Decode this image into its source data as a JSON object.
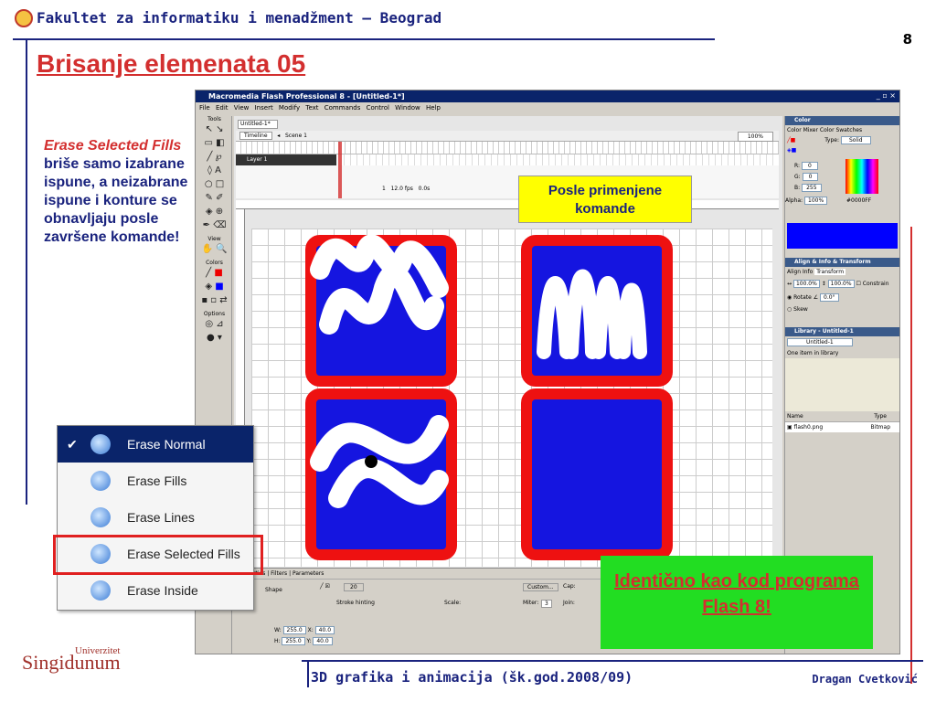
{
  "header": {
    "institution": "Fakultet za informatiku i menadžment – Beograd",
    "page_number": "8"
  },
  "title": "Brisanje elemenata 05",
  "description": {
    "highlight": "Erase Selected Fills",
    "rest": "briše samo izabrane ispune, a neizabrane ispune i konture se obnavljaju posle završene komande!"
  },
  "flash": {
    "window_title": "Macromedia Flash Professional 8 - [Untitled-1*]",
    "menu": [
      "File",
      "Edit",
      "View",
      "Insert",
      "Modify",
      "Text",
      "Commands",
      "Control",
      "Window",
      "Help"
    ],
    "doc_tab": "Untitled-1*",
    "timeline_label": "Timeline",
    "scene": "Scene 1",
    "zoom": "100%",
    "layer": "Layer 1",
    "fps": "12.0 fps",
    "time": "0.0s",
    "frame": "1",
    "tools_label": "Tools",
    "view_label": "View",
    "colors_label": "Colors",
    "options_label": "Options",
    "props_tab": "Properties",
    "filters_tab": "Filters",
    "params_tab": "Parameters",
    "shape_label": "Shape",
    "w": "255.0",
    "h": "255.0",
    "x": "40.0",
    "y": "40.0",
    "stroke_hinting": "Stroke hinting",
    "scale": "Scale:",
    "custom": "Custom...",
    "miter": "Miter:",
    "miter_val": "3",
    "cap": "Cap:",
    "join": "Join:",
    "stroke_size": "20"
  },
  "panels": {
    "color": {
      "title": "Color",
      "tab1": "Color Mixer",
      "tab2": "Color Swatches",
      "type_label": "Type:",
      "type_value": "Solid",
      "r_label": "R:",
      "r": "0",
      "g_label": "G:",
      "g": "0",
      "b_label": "B:",
      "b": "255",
      "alpha_label": "Alpha:",
      "alpha": "100%",
      "hex": "#0000FF"
    },
    "align": {
      "title": "Align & Info & Transform",
      "tabs": [
        "Align",
        "Info",
        "Transform"
      ],
      "w": "100.0%",
      "h": "100.0%",
      "constrain": "Constrain",
      "rotate": "Rotate",
      "rotate_val": "0.0°",
      "skew": "Skew"
    },
    "library": {
      "title": "Library - Untitled-1",
      "select": "Untitled-1",
      "count": "One item in library",
      "col_name": "Name",
      "col_type": "Type",
      "item_name": "flash0.png",
      "item_type": "Bitmap"
    }
  },
  "callouts": {
    "after": "Posle primenjene komande",
    "same": "Identično kao kod programa Flash 8!"
  },
  "eraser_menu": [
    {
      "label": "Erase Normal",
      "selected": true
    },
    {
      "label": "Erase Fills",
      "selected": false
    },
    {
      "label": "Erase Lines",
      "selected": false
    },
    {
      "label": "Erase Selected Fills",
      "selected": false
    },
    {
      "label": "Erase Inside",
      "selected": false
    }
  ],
  "footer": {
    "course": "3D grafika i animacija (šk.god.2008/09)",
    "author": "Dragan Cvetković",
    "logo_main": "Singidunum",
    "logo_sub": "Univerzitet"
  },
  "colors": {
    "accent_red": "#d32f2f",
    "navy": "#1a237e",
    "fill_blue": "#1515e0",
    "callout_yellow": "#ffff00",
    "callout_green": "#22dd22"
  }
}
